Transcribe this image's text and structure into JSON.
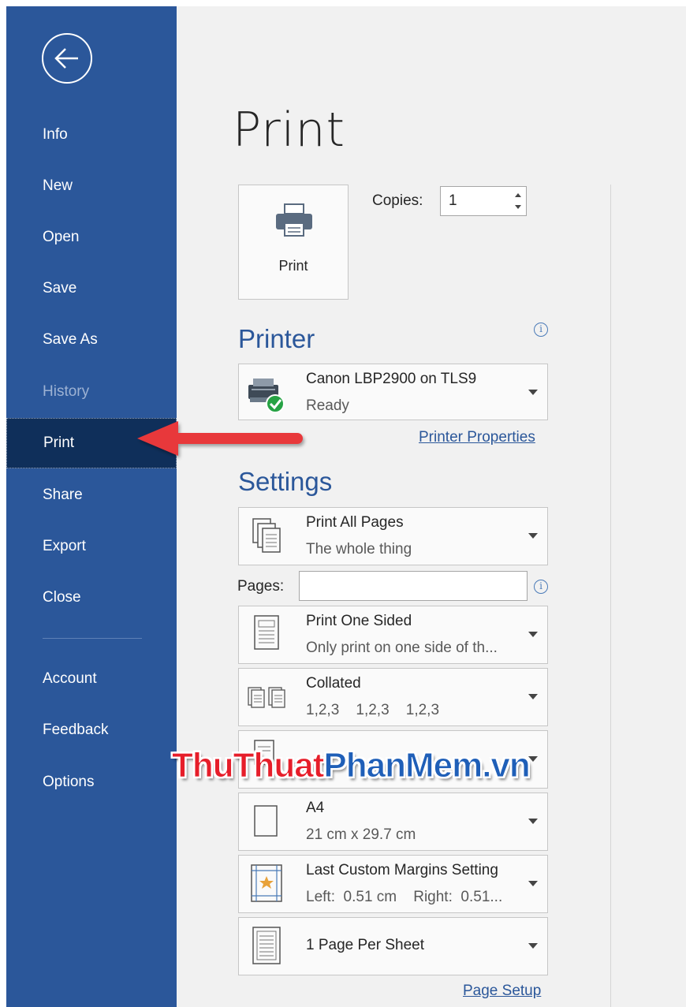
{
  "sidebar": {
    "back_icon": "back-arrow-icon",
    "items": [
      {
        "label": "Info"
      },
      {
        "label": "New"
      },
      {
        "label": "Open"
      },
      {
        "label": "Save"
      },
      {
        "label": "Save As"
      },
      {
        "label": "History",
        "disabled": true
      },
      {
        "label": "Print",
        "active": true
      },
      {
        "label": "Share"
      },
      {
        "label": "Export"
      },
      {
        "label": "Close"
      },
      {
        "label": "Account"
      },
      {
        "label": "Feedback"
      },
      {
        "label": "Options"
      }
    ]
  },
  "main": {
    "title": "Print",
    "print_button_label": "Print",
    "copies_label": "Copies:",
    "copies_value": "1",
    "printer_heading": "Printer",
    "printer": {
      "name": "Canon LBP2900 on TLS9",
      "status": "Ready"
    },
    "printer_properties_link": "Printer Properties",
    "settings_heading": "Settings",
    "pages_label": "Pages:",
    "pages_value": "",
    "settings": [
      {
        "title": "Print All Pages",
        "subtitle": "The whole thing",
        "icon": "pages-stack-icon"
      },
      {
        "title": "Print One Sided",
        "subtitle": "Only print on one side of th...",
        "icon": "one-sided-icon"
      },
      {
        "title": "Collated",
        "subtitle": "1,2,3    1,2,3    1,2,3",
        "icon": "collated-icon"
      },
      {
        "title": "",
        "subtitle": "",
        "icon": "orientation-icon"
      },
      {
        "title": "A4",
        "subtitle": "21 cm x 29.7 cm",
        "icon": "paper-size-icon"
      },
      {
        "title": "Last Custom Margins Setting",
        "subtitle": "Left:  0.51 cm    Right:  0.51...",
        "icon": "margins-icon"
      },
      {
        "title": "1 Page Per Sheet",
        "subtitle": "",
        "icon": "pages-per-sheet-icon"
      }
    ],
    "page_setup_link": "Page Setup"
  },
  "watermark": {
    "part1": "ThuThuat",
    "part2": "PhanMem.vn"
  },
  "colors": {
    "sidebar": "#2b579a",
    "active": "#0f2f5a",
    "accent": "#2b579a",
    "arrow": "#e8373a"
  }
}
